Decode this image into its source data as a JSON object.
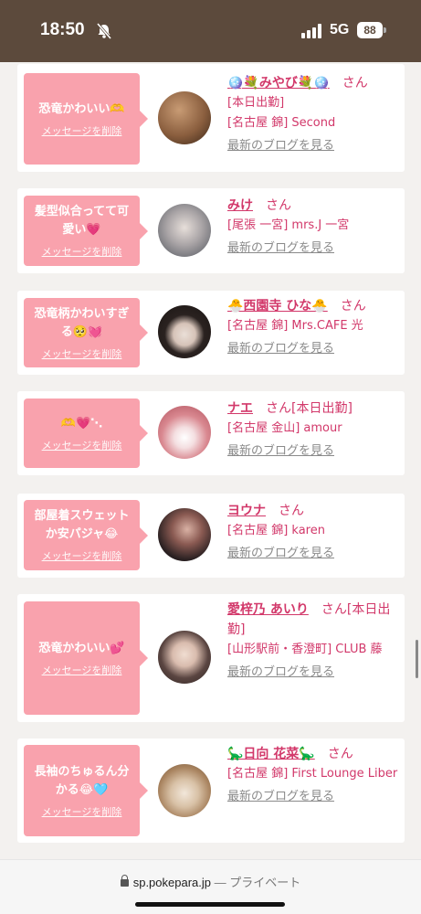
{
  "status_bar": {
    "time": "18:50",
    "network": "5G",
    "battery": "88"
  },
  "cards": [
    {
      "message": "恐竜かわいい🫶",
      "delete_label": "メッセージを削除",
      "name": "🪩💐みやび💐🪩",
      "san": "さん",
      "meta": [
        "[本日出勤]",
        "[名古屋 錦] Second"
      ],
      "blog_label": "最新のブログを見る",
      "avatar_colors": [
        "#6b4a33",
        "#c89b74"
      ]
    },
    {
      "message": "髪型似合ってて可愛い💗",
      "delete_label": "メッセージを削除",
      "name": "みけ",
      "san": "さん",
      "meta": [
        "[尾張 一宮] mrs.J 一宮"
      ],
      "blog_label": "最新のブログを見る",
      "avatar_colors": [
        "#7a7f88",
        "#d8d2cf"
      ]
    },
    {
      "message": "恐竜柄かわいすぎる🥺💓",
      "delete_label": "メッセージを削除",
      "name": "🐣西園寺 ひな🐣",
      "san": "さん",
      "meta": [
        "[名古屋 錦] Mrs.CAFE 光"
      ],
      "blog_label": "最新のブログを見る",
      "avatar_colors": [
        "#1e1a18",
        "#e9dcd4"
      ]
    },
    {
      "message": "🫶💗⋱",
      "delete_label": "メッセージを削除",
      "name": "ナエ",
      "san": "さん[本日出勤]",
      "meta": [
        "[名古屋 金山] amour"
      ],
      "blog_label": "最新のブログを見る",
      "avatar_colors": [
        "#c9707a",
        "#f2d3d6"
      ]
    },
    {
      "message": "部屋着スウェットか安パジャ😂",
      "delete_label": "メッセージを削除",
      "name": "ヨウナ",
      "san": "さん",
      "meta": [
        "[名古屋 錦] karen"
      ],
      "blog_label": "最新のブログを見る",
      "avatar_colors": [
        "#2a2122",
        "#b98478"
      ]
    },
    {
      "message": "恐竜かわいい💕",
      "delete_label": "メッセージを削除",
      "name": "愛梓乃 あいり",
      "san": "さん[本日出勤]",
      "meta": [
        "[山形駅前・香澄町] CLUB 藤"
      ],
      "blog_label": "最新のブログを見る",
      "avatar_colors": [
        "#3b2e2b",
        "#e6cdbf"
      ]
    },
    {
      "message": "長袖のちゅるん分かる😂🩵",
      "delete_label": "メッセージを削除",
      "name": "🦕日向 花菜🦕",
      "san": "さん",
      "meta": [
        "[名古屋 錦] First Lounge Liber"
      ],
      "blog_label": "最新のブログを見る",
      "avatar_colors": [
        "#c7a279",
        "#efe3d4"
      ]
    }
  ],
  "browser_bar": {
    "domain": "sp.pokepara.jp",
    "separator": "—",
    "mode": "プライベート"
  }
}
